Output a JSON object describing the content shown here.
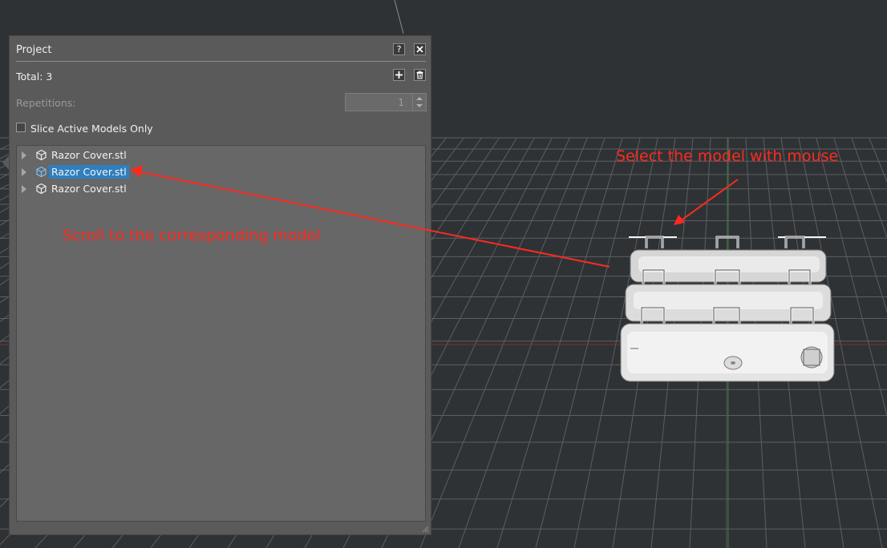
{
  "panel": {
    "title": "Project",
    "help_icon": "question-mark-icon",
    "close_icon": "close-icon",
    "total_label": "Total: 3",
    "add_icon": "plus-icon",
    "delete_icon": "trash-icon",
    "repetitions_label": "Repetitions:",
    "repetitions_value": "1",
    "slice_active_label": "Slice Active Models Only",
    "slice_active_checked": false,
    "models": [
      {
        "label": "Razor Cover.stl",
        "icon": "cube-icon",
        "selected": false
      },
      {
        "label": "Razor Cover.stl",
        "icon": "cube-icon",
        "selected": true
      },
      {
        "label": "Razor Cover.stl",
        "icon": "cube-icon",
        "selected": false
      }
    ]
  },
  "annotations": {
    "select_hint": "Select the model with mouse",
    "scroll_hint": "Scroll to the corresponding model"
  },
  "colors": {
    "background": "#2f3235",
    "panel": "#5a5a5a",
    "selection": "#2f7fbf",
    "annotation": "#ff2a1f",
    "grid_line": "#5c5f62"
  }
}
